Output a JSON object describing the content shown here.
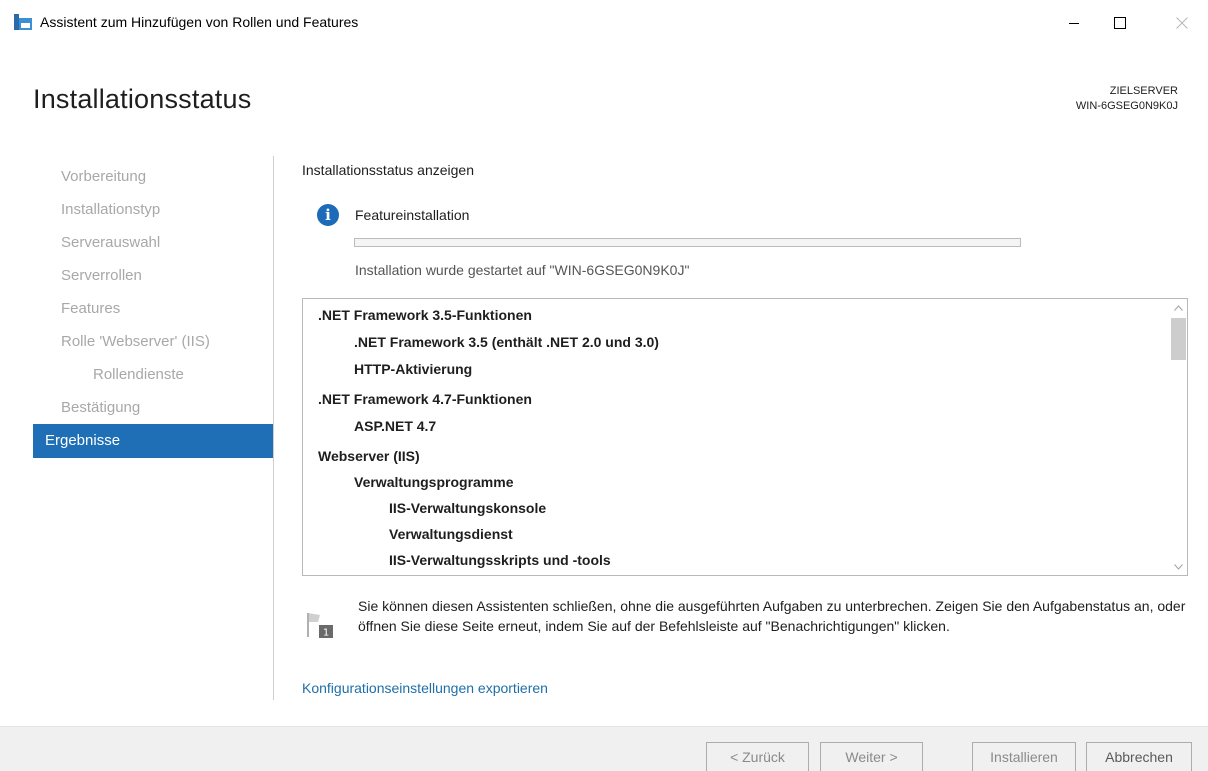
{
  "window": {
    "title": "Assistent zum Hinzufügen von Rollen und Features",
    "controls": [
      "minimize-icon",
      "maximize-icon",
      "close-icon"
    ]
  },
  "header": {
    "page_title": "Installationsstatus",
    "server_label": "ZIELSERVER",
    "server_name": "WIN-6GSEG0N9K0J"
  },
  "nav": {
    "items": [
      {
        "label": "Vorbereitung"
      },
      {
        "label": "Installationstyp"
      },
      {
        "label": "Serverauswahl"
      },
      {
        "label": "Serverrollen"
      },
      {
        "label": "Features"
      },
      {
        "label": "Rolle 'Webserver' (IIS)"
      },
      {
        "label": "Rollendienste"
      },
      {
        "label": "Bestätigung"
      },
      {
        "label": "Ergebnisse"
      }
    ],
    "active_index": 8
  },
  "main": {
    "section_label": "Installationsstatus anzeigen",
    "status_icon": "info-icon",
    "feature_label": "Featureinstallation",
    "progress": 0,
    "install_note": "Installation wurde gestartet auf \"WIN-6GSEG0N9K0J\"",
    "features": [
      {
        "label": ".NET Framework 3.5-Funktionen",
        "level": 0
      },
      {
        "label": ".NET Framework 3.5 (enthält .NET 2.0 und 3.0)",
        "level": 1
      },
      {
        "label": "HTTP-Aktivierung",
        "level": 1
      },
      {
        "label": ".NET Framework 4.7-Funktionen",
        "level": 0
      },
      {
        "label": "ASP.NET 4.7",
        "level": 1
      },
      {
        "label": "Webserver (IIS)",
        "level": 0
      },
      {
        "label": "Verwaltungsprogramme",
        "level": 1
      },
      {
        "label": "IIS-Verwaltungskonsole",
        "level": 2
      },
      {
        "label": "Verwaltungsdienst",
        "level": 2
      },
      {
        "label": "IIS-Verwaltungsskripts und -tools",
        "level": 2
      }
    ],
    "notice_badge": "1",
    "notice_text": "Sie können diesen Assistenten schließen, ohne die ausgeführten Aufgaben zu unterbrechen. Zeigen Sie den Aufgabenstatus an, oder öffnen Sie diese Seite erneut, indem Sie auf der Befehlsleiste auf \"Benachrichtigungen\" klicken.",
    "export_link": "Konfigurationseinstellungen exportieren"
  },
  "footer": {
    "back_label": "< Zurück",
    "next_label": "Weiter >",
    "install_label": "Installieren",
    "cancel_label": "Abbrechen"
  },
  "colors": {
    "accent": "#1e6fb5",
    "link": "#1e6fa8",
    "info": "#1d6bb8",
    "nav_inactive": "#a8a8a8"
  }
}
